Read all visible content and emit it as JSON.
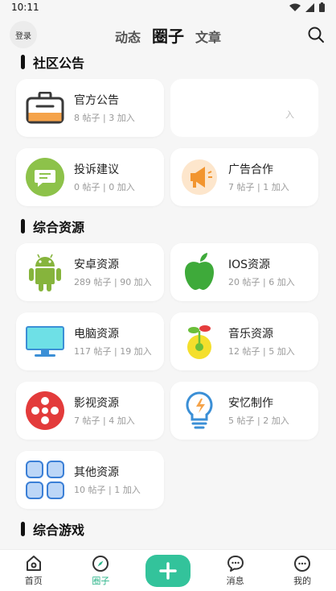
{
  "status": {
    "time": "10:11"
  },
  "header": {
    "login_label": "登录",
    "tabs": [
      {
        "label": "动态",
        "active": false
      },
      {
        "label": "圈子",
        "active": true
      },
      {
        "label": "文章",
        "active": false
      }
    ]
  },
  "sections": [
    {
      "title": "社区公告",
      "cards": [
        {
          "name": "官方公告",
          "meta": "8 帖子 | 3 加入",
          "icon": "briefcase-icon"
        },
        {
          "name": "",
          "meta": "入",
          "icon": "blank",
          "ghost": true
        },
        {
          "name": "投诉建议",
          "meta": "0 帖子 | 0 加入",
          "icon": "chat-bubble-icon"
        },
        {
          "name": "广告合作",
          "meta": "7 帖子 | 1 加入",
          "icon": "megaphone-icon"
        }
      ]
    },
    {
      "title": "综合资源",
      "cards": [
        {
          "name": "安卓资源",
          "meta": "289 帖子 | 90 加入",
          "icon": "android-icon"
        },
        {
          "name": "IOS资源",
          "meta": "20 帖子 | 6 加入",
          "icon": "apple-icon"
        },
        {
          "name": "电脑资源",
          "meta": "117 帖子 | 19 加入",
          "icon": "monitor-icon"
        },
        {
          "name": "音乐资源",
          "meta": "12 帖子 | 5 加入",
          "icon": "music-sprout-icon"
        },
        {
          "name": "影视资源",
          "meta": "7 帖子 | 4 加入",
          "icon": "film-reel-icon"
        },
        {
          "name": "安忆制作",
          "meta": "5 帖子 | 2 加入",
          "icon": "lightbulb-icon"
        },
        {
          "name": "其他资源",
          "meta": "10 帖子 | 1 加入",
          "icon": "tiles-icon"
        }
      ]
    },
    {
      "title": "综合游戏",
      "cards": []
    }
  ],
  "bottom_nav": [
    {
      "label": "首页",
      "icon": "home-icon",
      "active": false
    },
    {
      "label": "圈子",
      "icon": "compass-icon",
      "active": true
    },
    {
      "label": "",
      "icon": "plus-icon",
      "active": false
    },
    {
      "label": "消息",
      "icon": "message-icon",
      "active": false
    },
    {
      "label": "我的",
      "icon": "profile-icon",
      "active": false
    }
  ],
  "colors": {
    "accent": "#33c39b",
    "background": "#f6f6f6"
  }
}
